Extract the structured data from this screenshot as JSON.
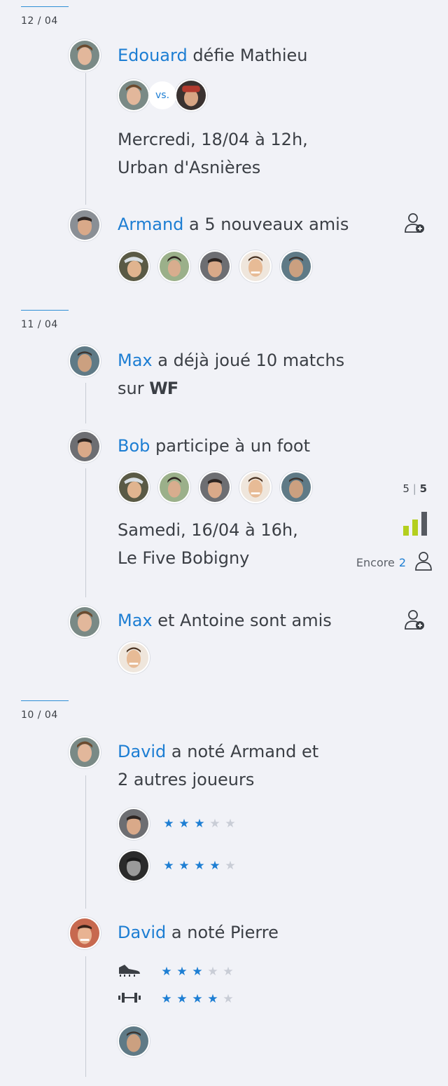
{
  "feed": [
    {
      "date": "12 / 04",
      "items": [
        {
          "name": "Edouard",
          "text": " défie Mathieu",
          "vs": "vs.",
          "details": [
            "Mercredi, 18/04 à 12h,",
            "Urban d'Asnières"
          ]
        },
        {
          "name": "Armand",
          "text": " a 5 nouveaux amis",
          "icon": "add-friend-icon"
        }
      ]
    },
    {
      "date": "11 / 04",
      "items": [
        {
          "name": "Max",
          "text": " a déjà joué 10 matchs",
          "line2": "sur",
          "brand": "WF"
        },
        {
          "name": "Bob",
          "text": " participe à un foot",
          "details": [
            "Samedi, 16/04 à 16h,",
            "Le Five Bobigny"
          ],
          "count_current": "5",
          "count_total": "5",
          "encore_label": "Encore",
          "encore_value": "2"
        },
        {
          "name": "Max",
          "text": " et Antoine sont amis",
          "icon": "add-friend-icon"
        }
      ]
    },
    {
      "date": "10 / 04",
      "items": [
        {
          "name": "David",
          "text": " a noté Armand et",
          "line2": "2 autres joueurs",
          "ratings": [
            3,
            4
          ]
        },
        {
          "name": "David",
          "text": " a noté Pierre",
          "skill_ratings": [
            {
              "icon": "football-boot-icon",
              "value": 3
            },
            {
              "icon": "dumbbell-icon",
              "value": 4
            }
          ]
        }
      ]
    }
  ],
  "colors": {
    "accent": "#1d7ed3",
    "background": "#f1f2f7",
    "bar_green": "#b4cf1e",
    "bar_gray": "#565a61"
  }
}
